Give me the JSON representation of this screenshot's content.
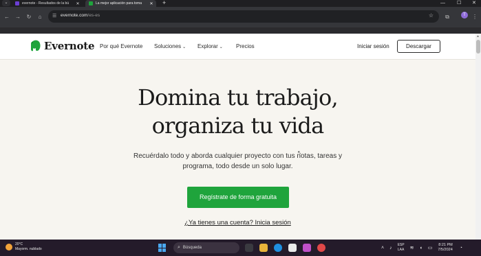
{
  "browser": {
    "tabs": [
      {
        "title": "evernote - Resultados de la bú",
        "favicon_color": "#6b3fd4",
        "active": false
      },
      {
        "title": "La mejor aplicación para toma",
        "favicon_color": "#1fa43c",
        "active": true
      }
    ],
    "new_tab_label": "+",
    "url_host": "evernote.com",
    "url_path": "/es-es",
    "profile_initial": "T"
  },
  "header": {
    "logo_text": "Evernote",
    "nav": [
      {
        "label": "Por qué Evernote",
        "dropdown": false
      },
      {
        "label": "Soluciones",
        "dropdown": true
      },
      {
        "label": "Explorar",
        "dropdown": true
      },
      {
        "label": "Precios",
        "dropdown": false
      }
    ],
    "login_label": "Iniciar sesión",
    "download_label": "Descargar"
  },
  "hero": {
    "title_line1": "Domina tu trabajo,",
    "title_line2": "organiza tu vida",
    "subtitle_line1": "Recuérdalo todo y aborda cualquier proyecto con tus notas, tareas y",
    "subtitle_line2": "programa, todo desde un solo lugar.",
    "cta_label": "Regístrate de forma gratuita",
    "have_account_label": "¿Ya tienes una cuenta? Inicia sesión"
  },
  "taskbar": {
    "weather_temp": "20°C",
    "weather_desc": "Mayorm. nublado",
    "search_placeholder": "Búsqueda",
    "lang_line1": "ESP",
    "lang_line2": "LAA",
    "time": "8:21 PM",
    "date": "7/5/2024"
  },
  "colors": {
    "brand_green": "#1fa43c",
    "page_bg": "#f7f5f0"
  }
}
